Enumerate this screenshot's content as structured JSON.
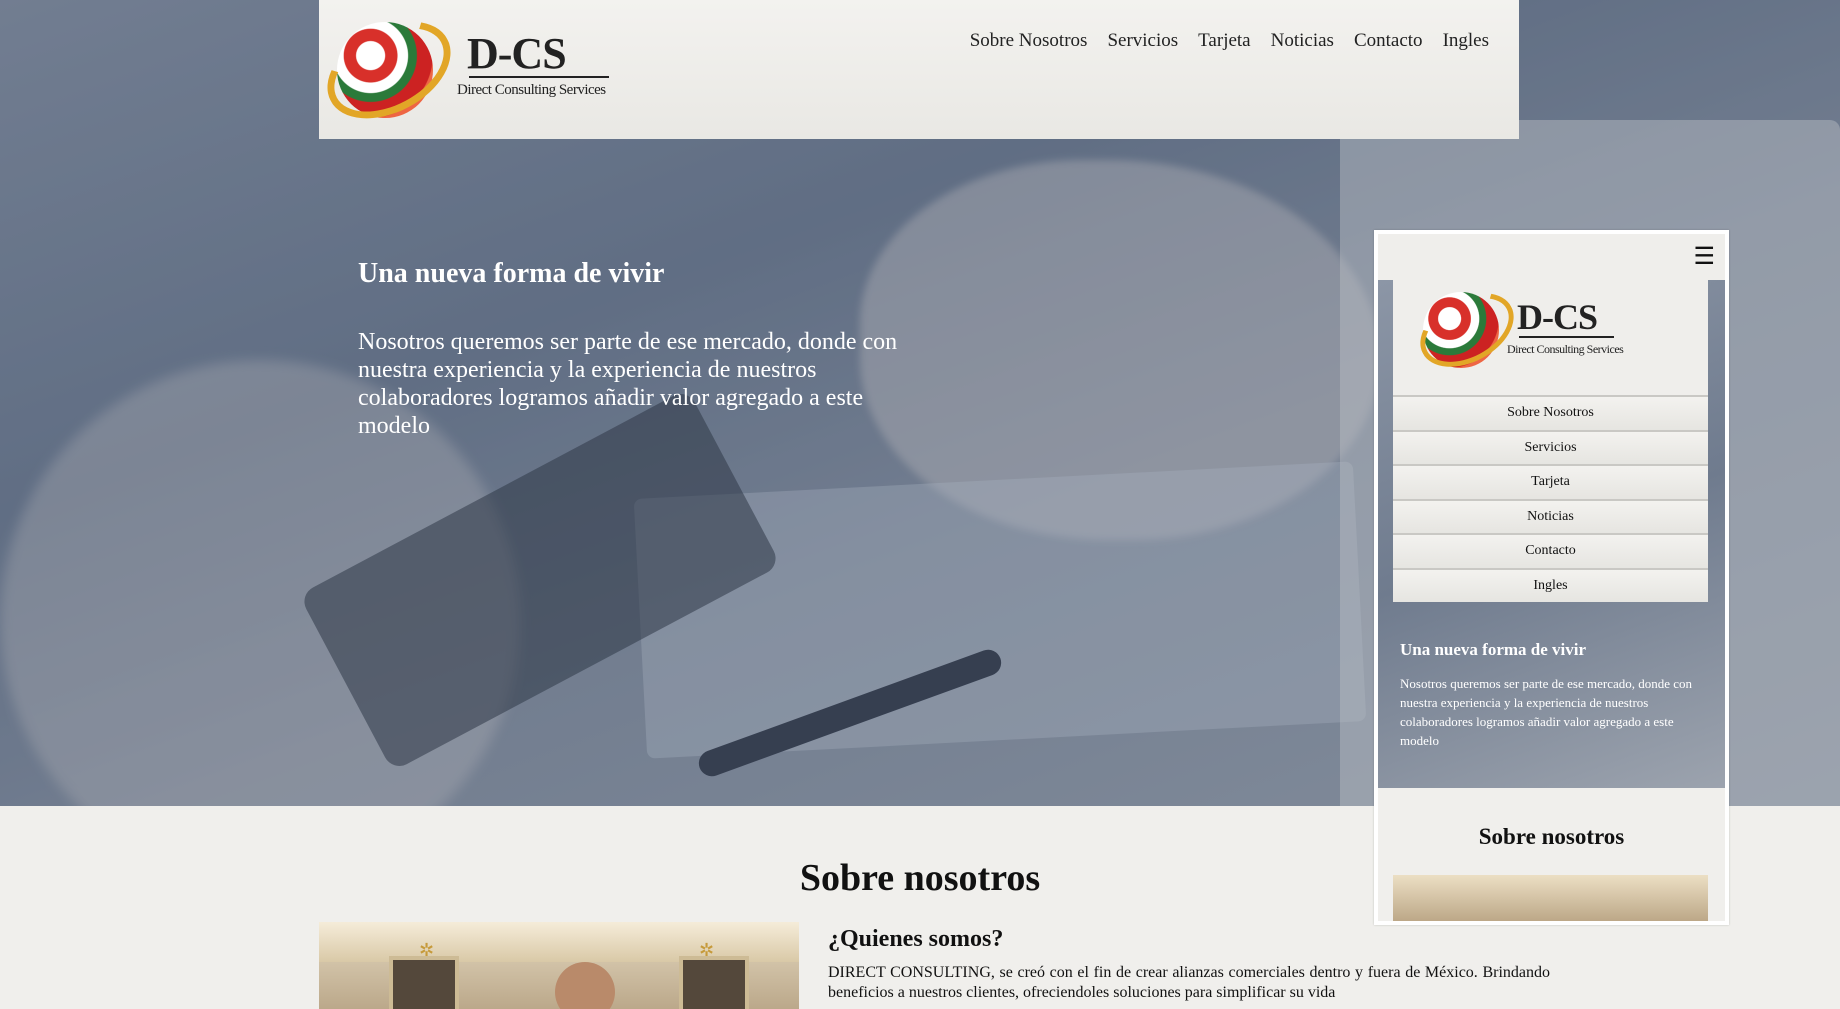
{
  "brand": {
    "title": "D-CS",
    "subtitle": "Direct Consulting Services"
  },
  "nav": [
    "Sobre Nosotros",
    "Servicios",
    "Tarjeta",
    "Noticias",
    "Contacto",
    "Ingles"
  ],
  "hero": {
    "heading": "Una nueva forma de vivir",
    "text": "Nosotros queremos ser parte de ese mercado, donde con nuestra experiencia y la experiencia de nuestros colaboradores logramos añadir valor agregado a este modelo"
  },
  "about": {
    "section_title": "Sobre nosotros",
    "heading": "¿Quienes somos?",
    "text": "DIRECT CONSULTING, se creó con el fin de crear alianzas comerciales dentro y fuera de México. Brindando beneficios a nuestros clientes, ofreciendoles soluciones para simplificar su vida"
  },
  "mobile": {
    "menu_icon": "☰",
    "section_title": "Sobre nosotros"
  },
  "colors": {
    "accent_gold": "#e2a627",
    "header_bg": "#efeeeb"
  }
}
